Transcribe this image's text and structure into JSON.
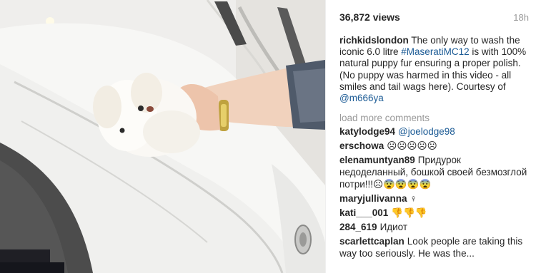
{
  "post": {
    "views": "36,872 views",
    "time": "18h",
    "caption": {
      "username": "richkidslondon",
      "text_1": " The only way to wash the iconic 6.0 litre ",
      "hashtag": "#MaseratiMC12",
      "text_2": " is with 100% natural puppy fur ensuring a proper polish. (No puppy was harmed in this video - all smiles and tail wags here). Courtesy of ",
      "mention": "@m666ya"
    },
    "load_more": "load more comments",
    "comments": [
      {
        "user": "katylodge94",
        "text": "",
        "mention": "@joelodge98"
      },
      {
        "user": "erschowa",
        "text": "☹☹☹☹☹",
        "mention": ""
      },
      {
        "user": "elenamuntyan89",
        "text": "Придурок недоделанный, бошкой своей безмозглой потри!!!☹😨😨😨😨",
        "mention": ""
      },
      {
        "user": "maryjullivanna",
        "text": "♀",
        "mention": ""
      },
      {
        "user": "kati___001",
        "text": "👎👎👎",
        "mention": ""
      },
      {
        "user": "284_619",
        "text": "Идиот",
        "mention": ""
      },
      {
        "user": "scarlettcaplan",
        "text": "Look people are taking this way too seriously. He was the...",
        "mention": ""
      }
    ]
  }
}
